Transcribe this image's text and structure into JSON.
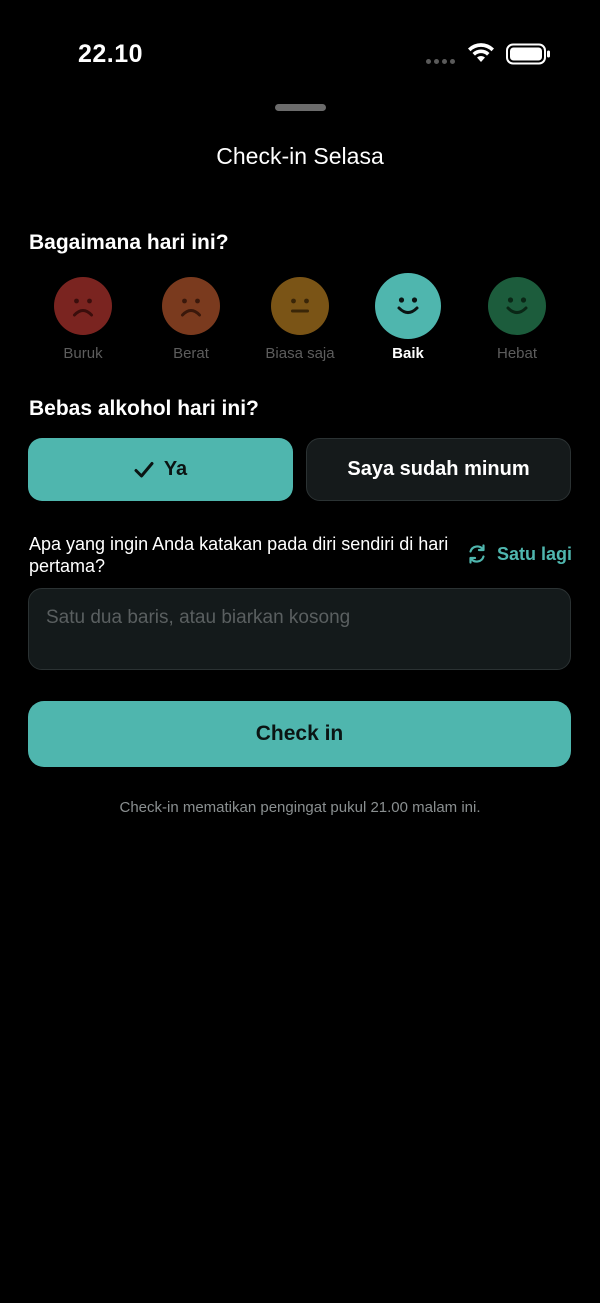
{
  "status_bar": {
    "time": "22.10"
  },
  "sheet": {
    "title": "Check-in Selasa"
  },
  "mood": {
    "question": "Bagaimana hari ini?",
    "selected": "Baik",
    "options": [
      {
        "label": "Buruk",
        "face": "frown-icon",
        "color": "#7a2420",
        "feature": "#3b0e0c"
      },
      {
        "label": "Berat",
        "face": "frown-icon",
        "color": "#7a3a1e",
        "feature": "#3a180b"
      },
      {
        "label": "Biasa saja",
        "face": "neutral-face-icon",
        "color": "#7a5416",
        "feature": "#3a2608"
      },
      {
        "label": "Baik",
        "face": "smile-icon",
        "color": "#4fb6ae",
        "feature": "#0b1413"
      },
      {
        "label": "Hebat",
        "face": "smile-icon",
        "color": "#1c5c3c",
        "feature": "#0a2716"
      }
    ]
  },
  "alcohol": {
    "question": "Bebas alkohol hari ini?",
    "yes_label": "Ya",
    "no_label": "Saya sudah minum",
    "selected": "Ya"
  },
  "note": {
    "prompt": "Apa yang ingin Anda katakan pada diri sendiri di hari pertama?",
    "another_label": "Satu lagi",
    "placeholder": "Satu dua baris, atau biarkan kosong",
    "value": ""
  },
  "checkin": {
    "button_label": "Check in",
    "footnote": "Check-in mematikan pengingat pukul 21.00 malam ini."
  },
  "colors": {
    "accent": "#4fb6ae",
    "background": "#000000"
  }
}
